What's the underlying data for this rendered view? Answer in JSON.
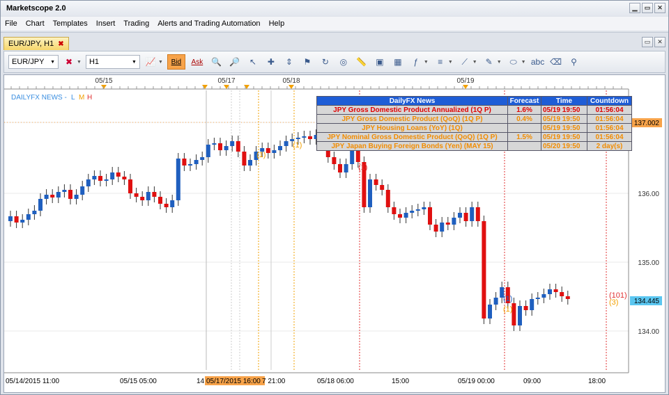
{
  "app": {
    "title": "Marketscope 2.0"
  },
  "menu": [
    "File",
    "Chart",
    "Templates",
    "Insert",
    "Trading",
    "Alerts and Trading Automation",
    "Help"
  ],
  "tab": {
    "label": "EUR/JPY, H1",
    "close": "✖"
  },
  "toolbar": {
    "symbol": "EUR/JPY",
    "timeframe": "H1",
    "bid": "Bid",
    "ask": "Ask"
  },
  "chart": {
    "indicator_label": "DAILYFX NEWS -",
    "indicator_flags": [
      "L",
      "M",
      "H"
    ],
    "top_dates": [
      "05/15",
      "05/17",
      "05/18",
      "05/19"
    ],
    "bottom_labels": [
      "05/14/2015 11:00",
      "05/15 05:00",
      "14",
      "05/17/2015 16:00",
      "7 21:00",
      "05/18 06:00",
      "15:00",
      "05/19 00:00",
      "09:00",
      "18:00"
    ],
    "price_levels": [
      "136.00",
      "135.00",
      "134.00"
    ],
    "current_price": "137.002",
    "last_price": "134.445",
    "event_markers": [
      "(1)",
      "(1)",
      "(1)",
      "(1)",
      "(1)",
      "(101)",
      "(3)"
    ]
  },
  "news": {
    "headers": [
      "DailyFX News",
      "Forecast",
      "Time",
      "Countdown"
    ],
    "rows": [
      {
        "event": "JPY Gross Domestic Product Annualized (1Q P)",
        "forecast": "1.6%",
        "time": "05/19 19:50",
        "countdown": "01:56:04",
        "severity": "high"
      },
      {
        "event": "JPY Gross Domestic Product (QoQ) (1Q P)",
        "forecast": "0.4%",
        "time": "05/19 19:50",
        "countdown": "01:56:04",
        "severity": "medium"
      },
      {
        "event": "JPY Housing Loans (YoY) (1Q)",
        "forecast": "",
        "time": "05/19 19:50",
        "countdown": "01:56:04",
        "severity": "medium"
      },
      {
        "event": "JPY Nominal Gross Domestic Product (QoQ) (1Q P)",
        "forecast": "1.5%",
        "time": "05/19 19:50",
        "countdown": "01:56:04",
        "severity": "medium"
      },
      {
        "event": "JPY Japan Buying Foreign Bonds (Yen) (MAY 15)",
        "forecast": "",
        "time": "05/20 19:50",
        "countdown": "2 day(s)",
        "severity": "medium"
      }
    ]
  },
  "colors": {
    "up": "#1f5fbf",
    "down": "#e01010",
    "accent": "#f7a34a"
  }
}
